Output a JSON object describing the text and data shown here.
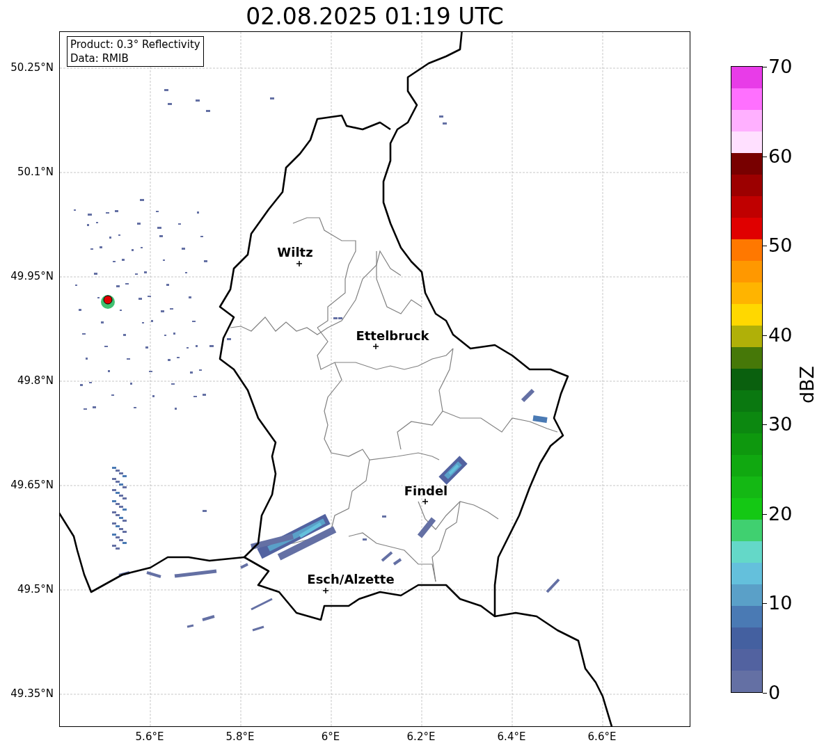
{
  "title": "02.08.2025 01:19 UTC",
  "info_box": {
    "lines": [
      "Product: 0.3° Reflectivity",
      "Data: RMIB"
    ]
  },
  "map": {
    "lat_ticks": [
      "50.25°N",
      "50.1°N",
      "49.95°N",
      "49.8°N",
      "49.65°N",
      "49.5°N",
      "49.35°N"
    ],
    "lon_ticks": [
      "5.6°E",
      "5.8°E",
      "6°E",
      "6.2°E",
      "6.4°E",
      "6.6°E"
    ],
    "cities": [
      {
        "name": "Wiltz"
      },
      {
        "name": "Ettelbruck"
      },
      {
        "name": "Findel"
      },
      {
        "name": "Esch/Alzette"
      }
    ]
  },
  "colorbar": {
    "label": "dBZ",
    "ticks": [
      "70",
      "60",
      "50",
      "40",
      "30",
      "20",
      "10",
      "0"
    ],
    "segments": [
      {
        "color": "#e83ce8"
      },
      {
        "color": "#ff70ff"
      },
      {
        "color": "#ffb0ff"
      },
      {
        "color": "#ffe0ff"
      },
      {
        "color": "#780000"
      },
      {
        "color": "#9c0000"
      },
      {
        "color": "#c00000"
      },
      {
        "color": "#e00000"
      },
      {
        "color": "#ff7800"
      },
      {
        "color": "#ff9800"
      },
      {
        "color": "#ffb400"
      },
      {
        "color": "#ffd800"
      },
      {
        "color": "#b0b008"
      },
      {
        "color": "#467808"
      },
      {
        "color": "#0a600e"
      },
      {
        "color": "#0a7810"
      },
      {
        "color": "#0c8810"
      },
      {
        "color": "#0e980e"
      },
      {
        "color": "#10a810"
      },
      {
        "color": "#14b814"
      },
      {
        "color": "#14c814"
      },
      {
        "color": "#40d070"
      },
      {
        "color": "#64d8c8"
      },
      {
        "color": "#64c0dc"
      },
      {
        "color": "#5aa0c8"
      },
      {
        "color": "#4a7ab4"
      },
      {
        "color": "#4460a0"
      },
      {
        "color": "#5262a0"
      },
      {
        "color": "#6470a4"
      }
    ]
  }
}
